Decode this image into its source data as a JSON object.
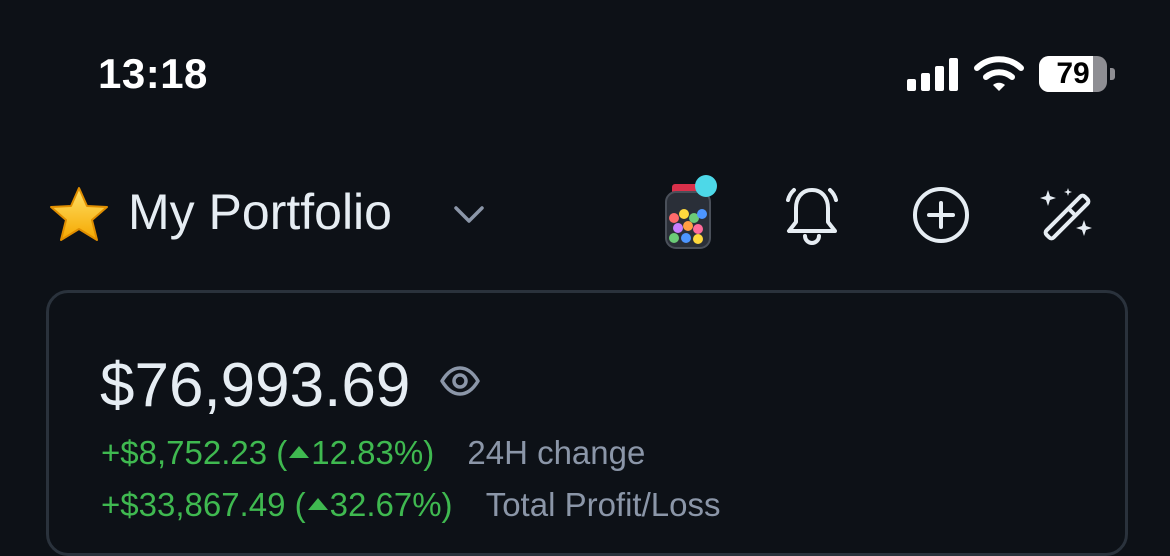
{
  "status_bar": {
    "time": "13:18",
    "battery_level": "79",
    "icons": [
      "cellular-signal-icon",
      "wifi-icon",
      "battery-icon"
    ]
  },
  "header": {
    "star_icon": "star-icon",
    "title": "My Portfolio",
    "dropdown_icon": "chevron-down-icon",
    "actions": [
      "candy-jar-icon",
      "bell-icon",
      "add-circle-icon",
      "magic-wand-icon"
    ]
  },
  "summary": {
    "balance": "$76,993.69",
    "visibility_icon": "eye-icon",
    "change_24h": {
      "amount": "+$8,752.23",
      "open_paren": "(",
      "percent": "12.83%)",
      "label": "24H change"
    },
    "total_pl": {
      "amount": "+$33,867.49",
      "open_paren": "(",
      "percent": "32.67%)",
      "label": "Total Profit/Loss"
    }
  },
  "colors": {
    "background": "#0d1117",
    "positive": "#3fb950",
    "muted_label": "#8b96a8",
    "card_border": "#2a323c",
    "notification_dot": "#4dd8e8"
  }
}
